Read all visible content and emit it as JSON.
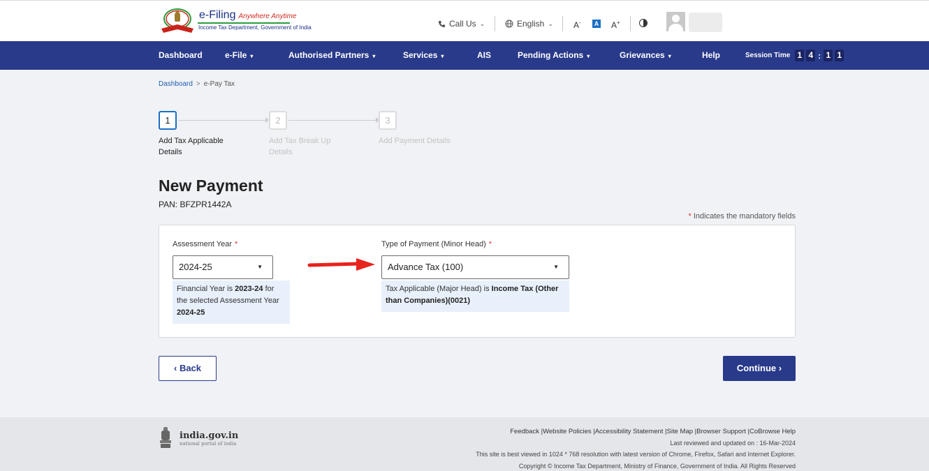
{
  "header": {
    "logo_title": "e-Filing",
    "logo_tagline": "Anywhere Anytime",
    "logo_subtitle": "Income Tax Department, Government of India",
    "call_us": "Call Us",
    "language": "English",
    "font_decrease": "A",
    "font_normal": "A",
    "font_increase": "A"
  },
  "nav": {
    "items": [
      "Dashboard",
      "e-File",
      "Authorised Partners",
      "Services",
      "AIS",
      "Pending Actions",
      "Grievances",
      "Help"
    ],
    "session_label": "Session Time",
    "session_digits": [
      "1",
      "4",
      "1",
      "1"
    ]
  },
  "breadcrumb": {
    "home": "Dashboard",
    "current": "e-Pay Tax"
  },
  "stepper": {
    "steps": [
      {
        "num": "1",
        "label": "Add Tax Applicable Details"
      },
      {
        "num": "2",
        "label": "Add Tax Break Up Details"
      },
      {
        "num": "3",
        "label": "Add Payment Details"
      }
    ],
    "active_step": 1
  },
  "page": {
    "title": "New Payment",
    "pan": "PAN: BFZPR1442A",
    "mandatory_note": "Indicates the mandatory fields"
  },
  "form": {
    "assessment_year_label": "Assessment Year",
    "assessment_year_value": "2024-25",
    "fy_hint_prefix": "Financial Year is",
    "fy_hint_fy": "2023-24",
    "fy_hint_mid": "for the selected Assessment Year",
    "fy_hint_ay": "2024-25",
    "payment_type_label": "Type of Payment (Minor Head)",
    "payment_type_value": "Advance Tax (100)",
    "major_head_prefix": "Tax Applicable (Major Head) is",
    "major_head_value": "Income Tax (Other than Companies)(0021)"
  },
  "buttons": {
    "back": "Back",
    "continue": "Continue"
  },
  "footer": {
    "portal_name": "india.gov.in",
    "portal_tagline": "national portal of india",
    "links": [
      "Feedback",
      "Website Policies",
      "Accessibility Statement",
      "Site Map",
      "Browser Support",
      "CoBrowse Help"
    ],
    "last_reviewed": "Last reviewed and updated on : 16-Mar-2024",
    "best_viewed": "This site is best viewed in 1024 * 768 resolution with latest version of Chrome, Firefox, Safari and Internet Explorer.",
    "copyright": "Copyright © Income Tax Department, Ministry of Finance, Government of India. All Rights Reserved"
  },
  "colors": {
    "nav_bg": "#293a8a",
    "accent": "#1a6fc4",
    "required": "#d32f2f",
    "annotation_arrow": "#e8231c"
  }
}
